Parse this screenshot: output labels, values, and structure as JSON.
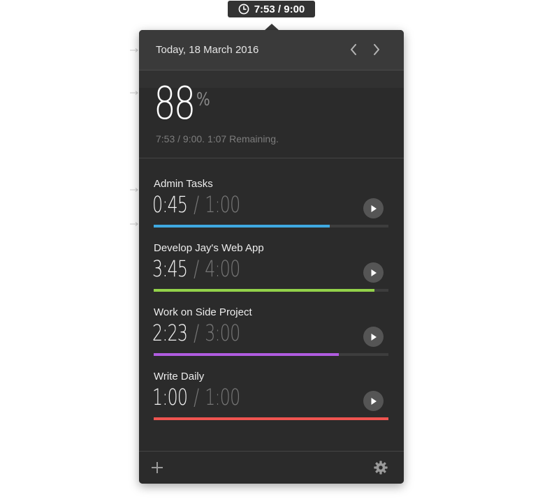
{
  "menubar": {
    "time_label": "7:53 / 9:00",
    "icon": "clock-icon"
  },
  "header": {
    "date": "Today, 18 March 2016",
    "prev_icon": "chevron-left-icon",
    "next_icon": "chevron-right-icon"
  },
  "summary": {
    "percent_value": "88",
    "percent_sign": "%",
    "status_text": "7:53 / 9:00. 1:07 Remaining."
  },
  "tasks": [
    {
      "name": "Admin Tasks",
      "elapsed": "0:45",
      "separator": "/",
      "target": "1:00",
      "progress": 0.75,
      "color": "#3fa9e0"
    },
    {
      "name": "Develop Jay's Web App",
      "elapsed": "3:45",
      "separator": "/",
      "target": "4:00",
      "progress": 0.94,
      "color": "#93d24a"
    },
    {
      "name": "Work on Side Project",
      "elapsed": "2:23",
      "separator": "/",
      "target": "3:00",
      "progress": 0.79,
      "color": "#b05ce0"
    },
    {
      "name": "Write Daily",
      "elapsed": "1:00",
      "separator": "/",
      "target": "1:00",
      "progress": 1.0,
      "color": "#ef5450"
    }
  ],
  "footer": {
    "add_icon": "plus-icon",
    "settings_icon": "gear-icon"
  },
  "colors": {
    "panel_bg": "#2b2b2b",
    "header_bg": "#3a3a3a"
  }
}
